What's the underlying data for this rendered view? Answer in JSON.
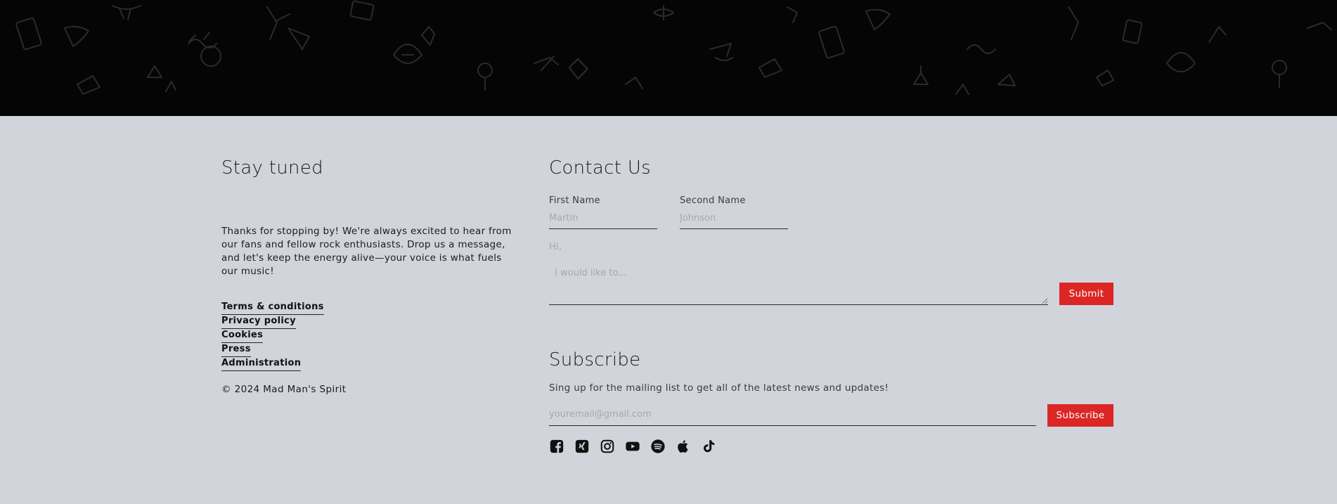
{
  "stay_tuned": {
    "title": "Stay tuned",
    "intro": "Thanks for stopping by! We're always excited to hear from our fans and fellow rock enthusiasts. Drop us a message, and let's keep the energy alive—your voice is what fuels our music!",
    "links": [
      {
        "label": "Terms & conditions"
      },
      {
        "label": "Privacy policy"
      },
      {
        "label": "Cookies"
      },
      {
        "label": "Press"
      },
      {
        "label": "Administration"
      }
    ],
    "copyright": "© 2024 Mad Man's Spirit"
  },
  "contact": {
    "title": "Contact Us",
    "first_name": {
      "label": "First Name",
      "placeholder": "Martin"
    },
    "second_name": {
      "label": "Second Name",
      "placeholder": "Johnson"
    },
    "message_greeting": "Hi,",
    "message_placeholder": " I would like to...",
    "submit_label": "Submit"
  },
  "subscribe": {
    "title": "Subscribe",
    "text": "Sing up for the mailing list to get all of the latest news and updates!",
    "email_placeholder": "youremail@gmail.com",
    "button_label": "Subscribe"
  },
  "social": [
    {
      "name": "facebook-icon"
    },
    {
      "name": "xing-icon"
    },
    {
      "name": "instagram-icon"
    },
    {
      "name": "youtube-icon"
    },
    {
      "name": "spotify-icon"
    },
    {
      "name": "apple-icon"
    },
    {
      "name": "tiktok-icon"
    }
  ],
  "colors": {
    "footer_bg": "#d1d4db",
    "hero_bg": "#050505",
    "accent": "#dc2626",
    "doodle": "#2b2b2b"
  }
}
